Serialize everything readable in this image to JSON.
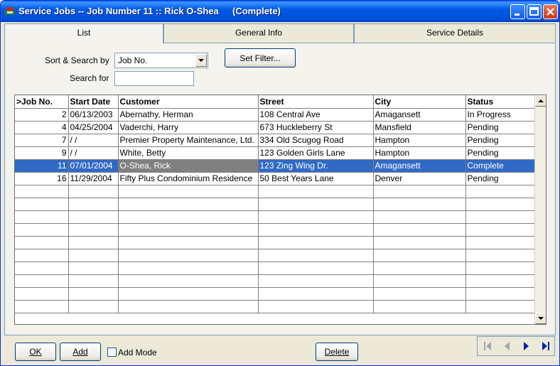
{
  "window": {
    "title": "Service Jobs -- Job Number 11 :: Rick O-Shea",
    "status": "(Complete)"
  },
  "tabs": [
    {
      "label": "List",
      "active": true
    },
    {
      "label": "General Info",
      "active": false
    },
    {
      "label": "Service Details",
      "active": false
    }
  ],
  "filter": {
    "sort_label": "Sort & Search by",
    "sort_value": "Job No.",
    "search_label": "Search for",
    "search_value": "",
    "set_filter_label": "Set Filter..."
  },
  "grid": {
    "columns": [
      ">Job No.",
      "Start Date",
      "Customer",
      "Street",
      "City",
      "Status"
    ],
    "rows": [
      {
        "job": "2",
        "date": "06/13/2003",
        "customer": "Abernathy, Herman",
        "street": "108 Central Ave",
        "city": "Amagansett",
        "status": "In Progress"
      },
      {
        "job": "4",
        "date": "04/25/2004",
        "customer": "Vaderchi, Harry",
        "street": "673 Huckleberry St",
        "city": "Mansfield",
        "status": "Pending"
      },
      {
        "job": "7",
        "date": "/ /",
        "customer": "Premier Property Maintenance, Ltd.",
        "street": "334 Old Scugog Road",
        "city": "Hampton",
        "status": "Pending"
      },
      {
        "job": "9",
        "date": "/ /",
        "customer": "White, Betty",
        "street": "123 Golden Girls Lane",
        "city": "Hampton",
        "status": "Pending"
      },
      {
        "job": "11",
        "date": "07/01/2004",
        "customer": "O-Shea, Rick",
        "street": "123 Zing Wing Dr.",
        "city": "Amagansett",
        "status": "Complete",
        "selected": true
      },
      {
        "job": "16",
        "date": "11/29/2004",
        "customer": "Fifty Plus Condominium Residence",
        "street": "50 Best Years Lane",
        "city": "Denver",
        "status": "Pending"
      }
    ]
  },
  "footer": {
    "ok_label": "OK",
    "add_label": "Add",
    "add_mode_label": "Add Mode",
    "add_mode_checked": false,
    "delete_label": "Delete"
  },
  "icons": {
    "app": "service-app-icon",
    "minimize": "minimize-icon",
    "maximize": "maximize-icon",
    "close": "close-icon",
    "first": "first-record-icon",
    "prev": "previous-record-icon",
    "next": "next-record-icon",
    "last": "last-record-icon"
  },
  "colors": {
    "titlebar": "#0058E6",
    "selection": "#316AC5",
    "nav_active": "#0A24A8",
    "nav_disabled": "#A7A6AA"
  }
}
